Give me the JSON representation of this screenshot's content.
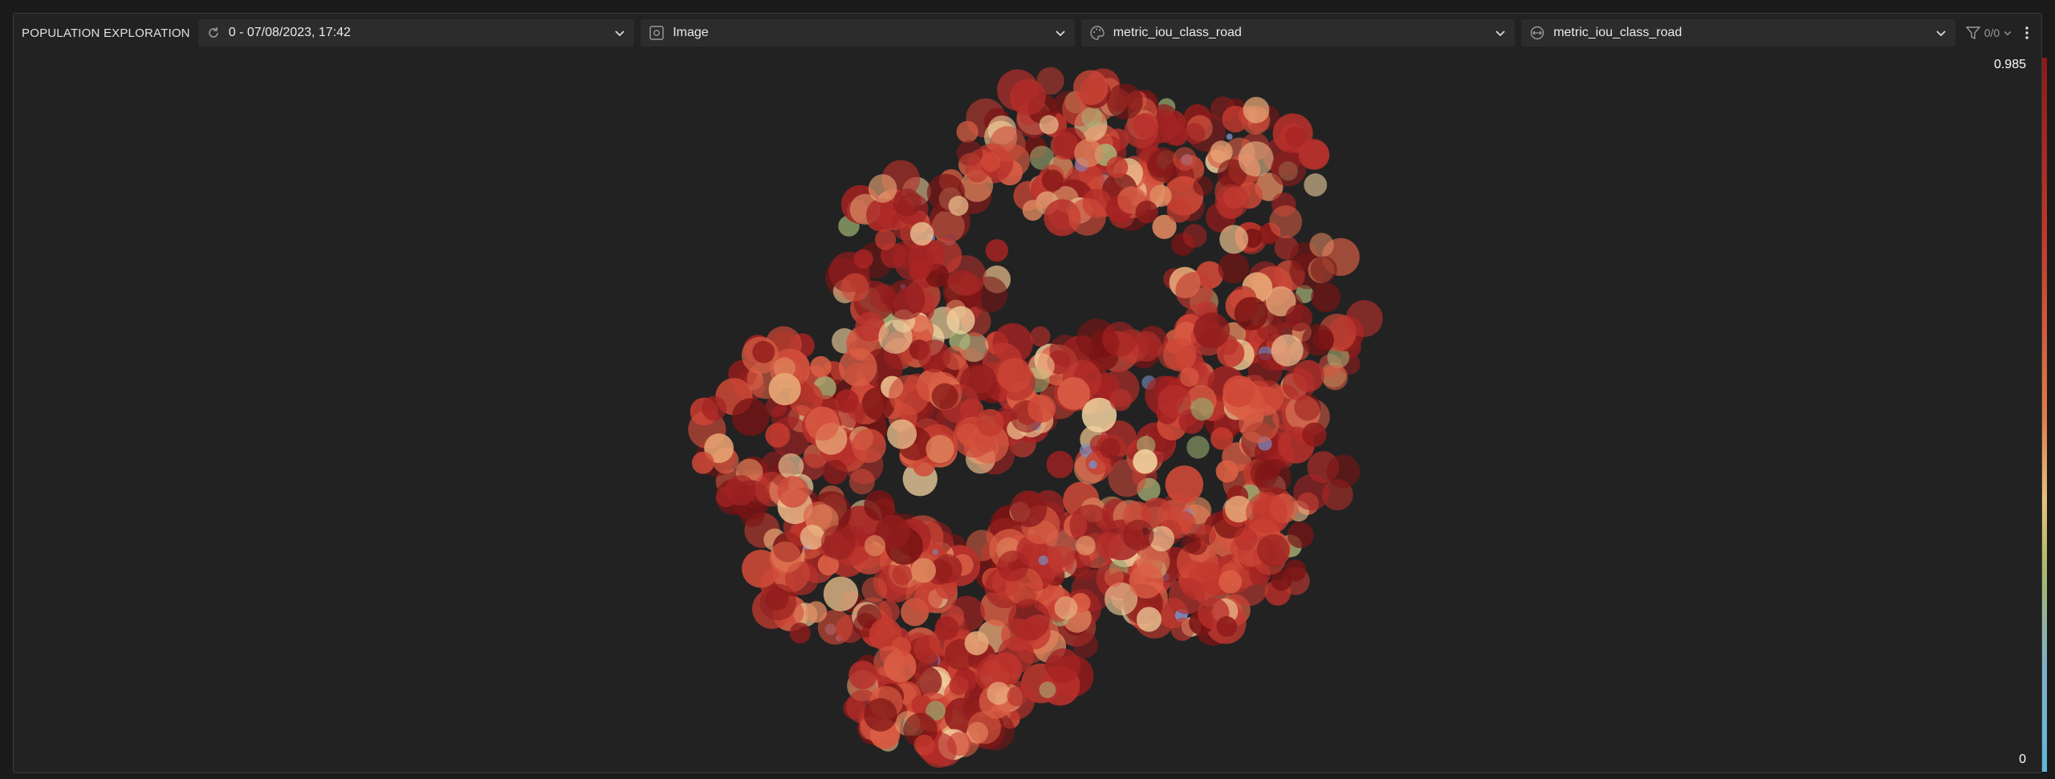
{
  "panel": {
    "title": "POPULATION EXPLORATION"
  },
  "toolbar": {
    "run_select": {
      "value": "0 - 07/08/2023, 17:42",
      "icon": "refresh-icon"
    },
    "view_select": {
      "value": "Image",
      "icon": "image-settings-icon"
    },
    "color_select": {
      "value": "metric_iou_class_road",
      "icon": "palette-icon"
    },
    "size_select": {
      "value": "metric_iou_class_road",
      "icon": "size-icon"
    },
    "filter": {
      "count": "0/0",
      "icon": "filter-icon"
    },
    "more_icon": "more-vertical-icon"
  },
  "colorbar": {
    "max_label": "0.985",
    "min_label": "0",
    "colors": [
      "#8b1a1a",
      "#c0392b",
      "#e07b4b",
      "#e8c07a",
      "#a9b86a",
      "#7fb0c8",
      "#5fb8d8"
    ]
  }
}
